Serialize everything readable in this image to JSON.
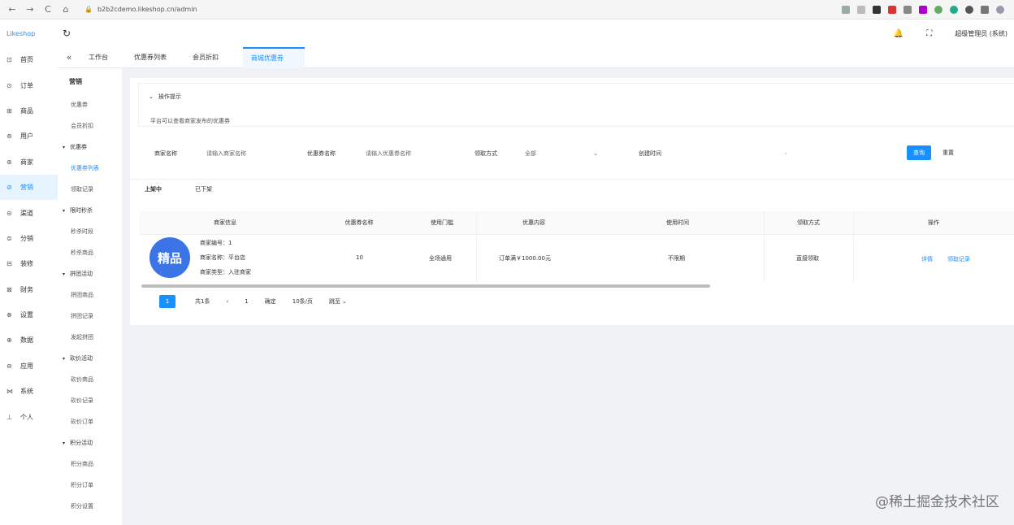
{
  "browser": {
    "back": "←",
    "forward": "→",
    "reload": "C",
    "home": "⌂",
    "lock": "🔒",
    "url": "b2b2cdemo.likeshop.cn/admin"
  },
  "header": {
    "logo": "Likeshop",
    "refresh_icon": "↻",
    "notice_icon": "🔔",
    "fullscreen_icon": "⛶",
    "user": "超级管理员 (系统)"
  },
  "sidebar": {
    "items": [
      {
        "icon": "⊡",
        "label": "首页"
      },
      {
        "icon": "⊙",
        "label": "订单"
      },
      {
        "icon": "⊞",
        "label": "商品"
      },
      {
        "icon": "⊚",
        "label": "用户"
      },
      {
        "icon": "⊛",
        "label": "商家"
      },
      {
        "icon": "⊘",
        "label": "营销"
      },
      {
        "icon": "⊝",
        "label": "渠道"
      },
      {
        "icon": "⊜",
        "label": "分销"
      },
      {
        "icon": "⊟",
        "label": "装修"
      },
      {
        "icon": "⊠",
        "label": "财务"
      },
      {
        "icon": "⊗",
        "label": "设置"
      },
      {
        "icon": "⊕",
        "label": "数据"
      },
      {
        "icon": "⊖",
        "label": "应用"
      },
      {
        "icon": "⋈",
        "label": "系统"
      },
      {
        "icon": "⊥",
        "label": "个人"
      }
    ]
  },
  "subnav": {
    "title": "营销",
    "items": [
      {
        "label": "优惠券",
        "type": "item"
      },
      {
        "label": "会员折扣",
        "type": "item"
      },
      {
        "label": "优惠券",
        "type": "group"
      },
      {
        "label": "优惠券列表",
        "type": "item",
        "active": true
      },
      {
        "label": "领取记录",
        "type": "item"
      },
      {
        "label": "限时秒杀",
        "type": "group"
      },
      {
        "label": "秒杀时段",
        "type": "item"
      },
      {
        "label": "秒杀商品",
        "type": "item"
      },
      {
        "label": "拼团活动",
        "type": "group"
      },
      {
        "label": "拼团商品",
        "type": "item"
      },
      {
        "label": "拼团记录",
        "type": "item"
      },
      {
        "label": "发起拼团",
        "type": "item"
      },
      {
        "label": "砍价活动",
        "type": "group"
      },
      {
        "label": "砍价商品",
        "type": "item"
      },
      {
        "label": "砍价记录",
        "type": "item"
      },
      {
        "label": "砍价订单",
        "type": "item"
      },
      {
        "label": "积分活动",
        "type": "group"
      },
      {
        "label": "积分商品",
        "type": "item"
      },
      {
        "label": "积分订单",
        "type": "item"
      },
      {
        "label": "积分设置",
        "type": "item"
      }
    ]
  },
  "tabs": {
    "collapse": "«",
    "items": [
      {
        "label": "工作台"
      },
      {
        "label": "优惠券列表"
      },
      {
        "label": "会员折扣"
      },
      {
        "label": "商城优惠券",
        "active": true
      }
    ]
  },
  "notice": {
    "title": "操作提示",
    "chevron": "⌄",
    "text": "平台可以查看商家发布的优惠券"
  },
  "filters": {
    "shop_label": "商家名称",
    "shop_placeholder": "请输入商家名称",
    "coupon_label": "优惠券名称",
    "coupon_placeholder": "请输入优惠券名称",
    "method_label": "领取方式",
    "method_value": "全部",
    "method_arrow": "⌄",
    "time_label": "创建时间",
    "time_value": "-",
    "query_button": "查询",
    "reset_button": "重置"
  },
  "subtabs": {
    "on": "上架中",
    "off": "已下架"
  },
  "table": {
    "headers": [
      "商家信息",
      "优惠券名称",
      "使用门槛",
      "优惠内容",
      "使用时间",
      "领取方式",
      "操作"
    ],
    "row": {
      "avatar_text": "精品",
      "shop_id": "商家编号：1",
      "shop_name": "商家名称：平台店",
      "shop_type": "商家类型：入驻商家",
      "coupon_name": "10",
      "threshold": "全场通用",
      "content": "订单满￥1000.00元",
      "time": "不限期",
      "method": "直接领取",
      "action1": "详情",
      "action2": "领取记录"
    }
  },
  "pagination": {
    "current": "1",
    "total": "共1条",
    "prev": "‹",
    "page_input": "1",
    "confirm": "确定",
    "page_size": "10条/页",
    "jump": "跳至",
    "jump_arrow": "⌄"
  },
  "watermark": "@稀土掘金技术社区"
}
